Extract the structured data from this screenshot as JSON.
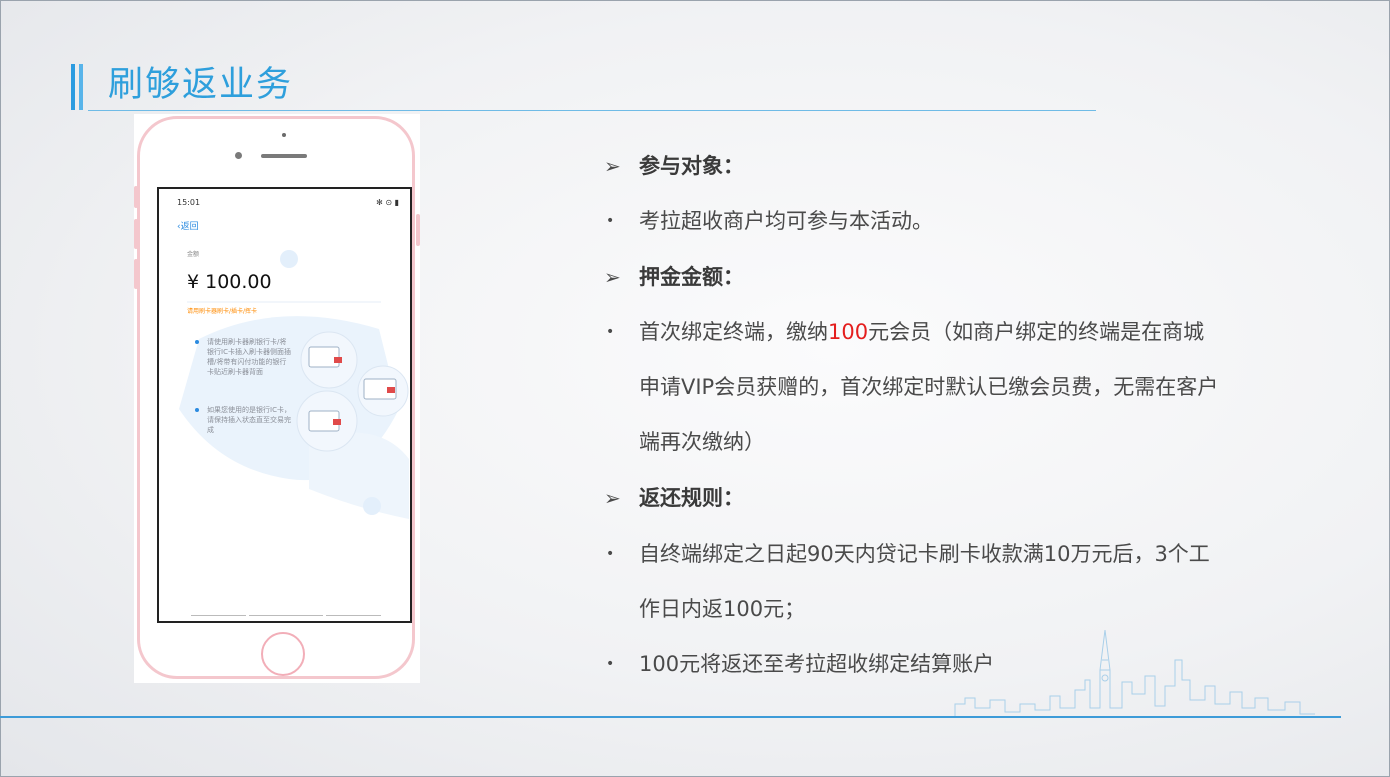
{
  "slide": {
    "title": "刷够返业务"
  },
  "phone": {
    "status_time": "15:01",
    "status_right": "✻ ⊙ ▮",
    "back_label": "返回",
    "amount_label": "金额",
    "amount": "¥ 100.00",
    "hint": "请用刷卡器刷卡/插卡/挥卡",
    "instructions": [
      "请使用刷卡器刷银行卡/将银行IC卡插入刷卡器侧面插槽/将带有闪付功能的银行卡贴近刷卡器背面",
      "如果您使用的是银行IC卡，请保持插入状态直至交易完成"
    ]
  },
  "content": {
    "section1_head": "参与对象：",
    "section1_item": "考拉超收商户均可参与本活动。",
    "section2_head": "押金金额：",
    "section2_line1_a": "首次绑定终端，缴纳",
    "section2_line1_red": "100",
    "section2_line1_b": "元会员（如商户绑定的终端是在商城",
    "section2_line2": "申请VIP会员获赠的，首次绑定时默认已缴会员费，无需在客户",
    "section2_line3": "端再次缴纳）",
    "section3_head": "返还规则：",
    "section3_item1_line1": "自终端绑定之日起90天内贷记卡刷卡收款满10万元后，3个工",
    "section3_item1_line2": "作日内返100元；",
    "section3_item2": "100元将返还至考拉超收绑定结算账户",
    "arrow_marker": "➢",
    "bullet_marker": "•"
  },
  "colors": {
    "accent": "#2e9fdc",
    "highlight": "#e41e1e",
    "phone_border": "#f4c7cd"
  }
}
